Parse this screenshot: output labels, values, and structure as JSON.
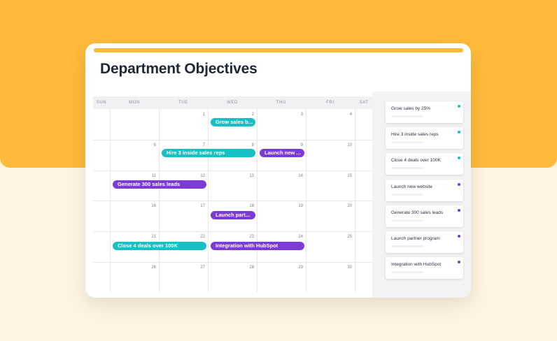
{
  "title": "Department Objectives",
  "colors": {
    "teal": "#17c0c4",
    "purple": "#7d3bd5",
    "accent": "#fdba3b"
  },
  "calendar": {
    "day_names": [
      "SUN",
      "MON",
      "TUE",
      "WED",
      "THU",
      "FRI",
      "SAT"
    ],
    "weeks": [
      [
        "",
        "",
        "1",
        "2",
        "3",
        "4",
        ""
      ],
      [
        "",
        "6",
        "7",
        "8",
        "9",
        "10",
        ""
      ],
      [
        "",
        "11",
        "12",
        "13",
        "14",
        "15",
        ""
      ],
      [
        "",
        "16",
        "17",
        "18",
        "19",
        "20",
        ""
      ],
      [
        "",
        "21",
        "22",
        "23",
        "24",
        "25",
        ""
      ],
      [
        "",
        "26",
        "27",
        "28",
        "29",
        "30",
        ""
      ]
    ],
    "events": [
      {
        "label": "Grow sales b...",
        "color": "teal"
      },
      {
        "label": "Hire 3 inside sales reps",
        "color": "teal"
      },
      {
        "label": "Launch new ...",
        "color": "purple"
      },
      {
        "label": "Generate 300 sales leads",
        "color": "purple"
      },
      {
        "label": "Launch part...",
        "color": "purple"
      },
      {
        "label": "Close 4 deals over 100K",
        "color": "teal"
      },
      {
        "label": "Integration with HubSpot",
        "color": "purple"
      }
    ]
  },
  "objectives": [
    {
      "label": "Grow sales by 25%",
      "color": "teal"
    },
    {
      "label": "Hire 3 inside sales reps",
      "color": "teal"
    },
    {
      "label": "Close 4 deals over 100K",
      "color": "teal"
    },
    {
      "label": "Launch new website",
      "color": "purple"
    },
    {
      "label": "Generate 300 sales leads",
      "color": "purple"
    },
    {
      "label": "Launch partner program",
      "color": "purple"
    },
    {
      "label": "Integration with HubSpot",
      "color": "purple"
    }
  ]
}
